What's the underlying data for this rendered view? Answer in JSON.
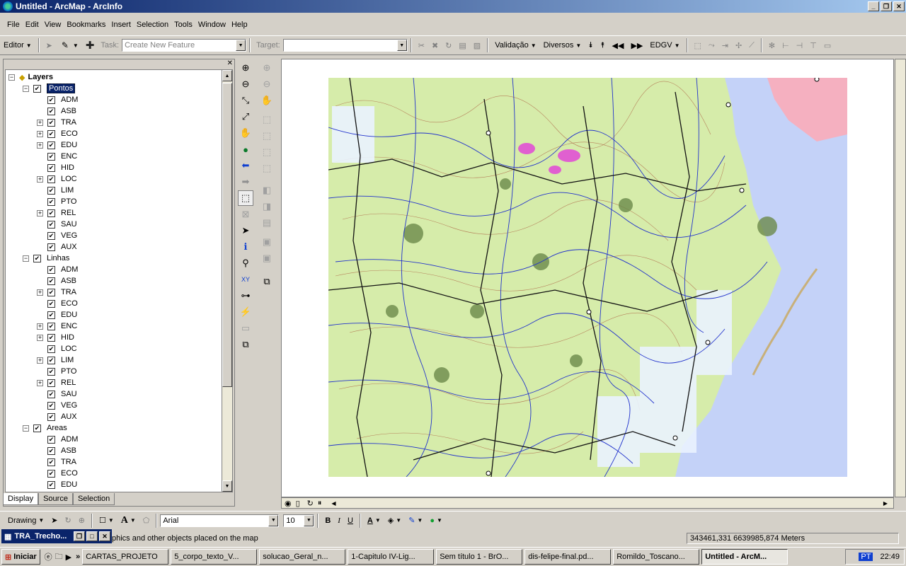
{
  "window": {
    "title": "Untitled - ArcMap - ArcInfo"
  },
  "menu": [
    "File",
    "Edit",
    "View",
    "Bookmarks",
    "Insert",
    "Selection",
    "Tools",
    "Window",
    "Help"
  ],
  "editor_toolbar": {
    "editor_label": "Editor",
    "task_label": "Task:",
    "task_value": "Create New Feature",
    "target_label": "Target:",
    "target_value": "",
    "validacao": "Validação",
    "diversos": "Diversos",
    "edgv": "EDGV"
  },
  "toc": {
    "root": "Layers",
    "groups": [
      {
        "name": "Pontos",
        "items": [
          "ADM",
          "ASB",
          "TRA",
          "ECO",
          "EDU",
          "ENC",
          "HID",
          "LOC",
          "LIM",
          "PTO",
          "REL",
          "SAU",
          "VEG",
          "AUX"
        ],
        "expandable": [
          "TRA",
          "ECO",
          "EDU",
          "LOC",
          "REL"
        ]
      },
      {
        "name": "Linhas",
        "items": [
          "ADM",
          "ASB",
          "TRA",
          "ECO",
          "EDU",
          "ENC",
          "HID",
          "LOC",
          "LIM",
          "PTO",
          "REL",
          "SAU",
          "VEG",
          "AUX"
        ],
        "expandable": [
          "TRA",
          "ENC",
          "HID",
          "LIM",
          "REL"
        ]
      },
      {
        "name": "Areas",
        "items": [
          "ADM",
          "ASB",
          "TRA",
          "ECO",
          "EDU"
        ],
        "expandable": []
      }
    ],
    "tabs": [
      "Display",
      "Source",
      "Selection"
    ]
  },
  "draw_toolbar": {
    "drawing_label": "Drawing",
    "font": "Arial",
    "size": "10"
  },
  "status": {
    "text": "phics and other objects placed on the map",
    "coords": "343461,331  6639985,874 Meters",
    "mini_window": "TRA_Trecho..."
  },
  "taskbar": {
    "start": "Iniciar",
    "tasks": [
      "CARTAS_PROJETO",
      "5_corpo_texto_V...",
      "solucao_Geral_n...",
      "1-Capitulo IV-Lig...",
      "Sem título 1 - BrO...",
      "dis-felipe-final.pd...",
      "Romildo_Toscano...",
      "Untitled - ArcM..."
    ],
    "lang": "PT",
    "clock": "22:49"
  },
  "colors": {
    "title_start": "#0a246a",
    "title_end": "#a6caf0",
    "map_land": "#d6ecaa",
    "map_water": "#c4d2f8",
    "map_river": "#2233cc"
  }
}
